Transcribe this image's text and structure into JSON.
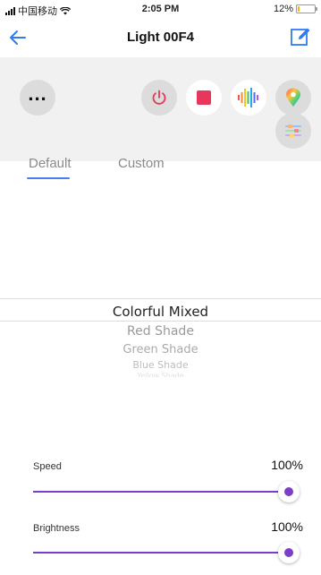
{
  "status_bar": {
    "carrier": "中国移动",
    "time": "2:05 PM",
    "battery_text": "12%",
    "battery_level": 0.12
  },
  "nav": {
    "title": "Light 00F4",
    "back_icon": "arrow-left-icon",
    "edit_icon": "edit-icon"
  },
  "controls": {
    "more_icon": "more-dots-icon",
    "power_icon": "power-icon",
    "stop_icon": "stop-square-icon",
    "music_icon": "music-bars-icon",
    "color_icon": "color-pin-icon",
    "settings_icon": "sliders-icon",
    "accent_red": "#e8375a"
  },
  "tabs": [
    {
      "label": "Default",
      "active": true
    },
    {
      "label": "Custom",
      "active": false
    }
  ],
  "effects": {
    "selected": "Colorful Mixed",
    "items": [
      "Colorful Mixed",
      "Red Shade",
      "Green Shade",
      "Blue Shade",
      "Yellow Shade"
    ]
  },
  "speed": {
    "label": "Speed",
    "value_text": "100%",
    "value": 1.0
  },
  "brightness": {
    "label": "Brightness",
    "value_text": "100%",
    "value": 1.0
  },
  "colors": {
    "accent_blue": "#4a7cf0",
    "slider_purple": "#7b3fc6"
  }
}
